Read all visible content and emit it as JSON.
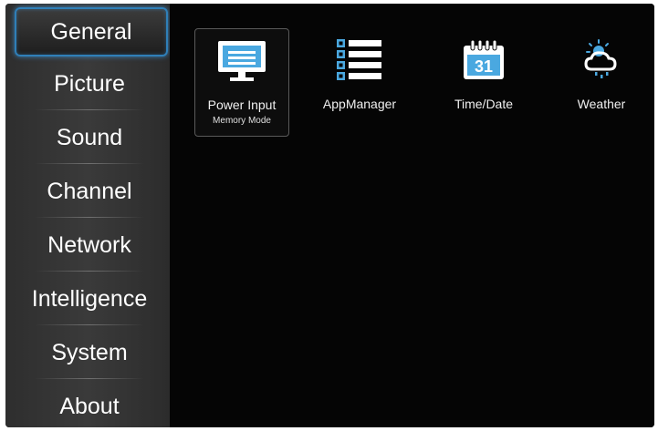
{
  "sidebar": {
    "items": [
      {
        "label": "General"
      },
      {
        "label": "Picture"
      },
      {
        "label": "Sound"
      },
      {
        "label": "Channel"
      },
      {
        "label": "Network"
      },
      {
        "label": "Intelligence"
      },
      {
        "label": "System"
      },
      {
        "label": "About"
      }
    ],
    "selected_index": 0
  },
  "content": {
    "tiles": [
      {
        "label": "Power Input",
        "sublabel": "Memory Mode",
        "icon": "monitor-icon"
      },
      {
        "label": "AppManager",
        "icon": "list-icon"
      },
      {
        "label": "Time/Date",
        "icon": "calendar-icon",
        "icon_text": "31"
      },
      {
        "label": "Weather",
        "icon": "weather-icon"
      }
    ]
  },
  "colors": {
    "accent_blue": "#2f7fb8",
    "icon_blue": "#4aa8e0",
    "background": "#050505",
    "sidebar": "#353535"
  }
}
